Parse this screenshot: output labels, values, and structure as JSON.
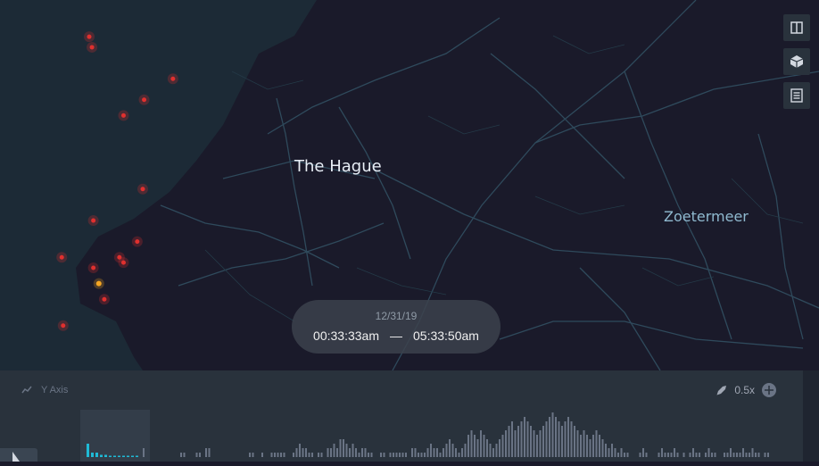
{
  "map": {
    "city_primary": "The Hague",
    "city_secondary": "Zoetermeer",
    "colors": {
      "water": "#1c2a36",
      "land": "#141420",
      "road": "#2f4a5c",
      "point": "#e0302e",
      "highlight": "#f5a623"
    },
    "points": [
      {
        "lng": 4.265,
        "lat": 52.118
      },
      {
        "lng": 4.267,
        "lat": 52.116
      },
      {
        "lng": 4.326,
        "lat": 52.11
      },
      {
        "lng": 4.29,
        "lat": 52.103
      },
      {
        "lng": 4.305,
        "lat": 52.106
      },
      {
        "lng": 4.304,
        "lat": 52.089
      },
      {
        "lng": 4.268,
        "lat": 52.083
      },
      {
        "lng": 4.3,
        "lat": 52.079
      },
      {
        "lng": 4.287,
        "lat": 52.076
      },
      {
        "lng": 4.29,
        "lat": 52.075
      },
      {
        "lng": 4.245,
        "lat": 52.076
      },
      {
        "lng": 4.268,
        "lat": 52.074
      },
      {
        "lng": 4.272,
        "lat": 52.071
      },
      {
        "lng": 4.276,
        "lat": 52.068
      },
      {
        "lng": 4.246,
        "lat": 52.063
      }
    ],
    "highlight_point_index": 12
  },
  "controls": {
    "split_icon": "split-map-icon",
    "view3d_icon": "cube-3d-icon",
    "legend_icon": "legend-icon"
  },
  "time": {
    "date": "12/31/19",
    "start": "00:33:33am",
    "separator": "—",
    "end": "05:33:50am"
  },
  "timeline": {
    "y_axis_label": "Y Axis",
    "speed": "0.5x",
    "highlight_color": "#1fbad6",
    "bar_color": "#6a7485",
    "bins": [
      2,
      0,
      0,
      0,
      0,
      0,
      0,
      0,
      0,
      0,
      0,
      0,
      1,
      1,
      0,
      0,
      0,
      1,
      1,
      0,
      2,
      2,
      0,
      0,
      0,
      0,
      0,
      0,
      0,
      0,
      0,
      0,
      0,
      0,
      1,
      1,
      0,
      0,
      1,
      0,
      0,
      1,
      1,
      1,
      1,
      1,
      0,
      0,
      1,
      2,
      3,
      2,
      2,
      1,
      1,
      0,
      1,
      1,
      0,
      2,
      2,
      3,
      2,
      4,
      4,
      3,
      2,
      3,
      2,
      1,
      2,
      2,
      1,
      1,
      0,
      0,
      1,
      1,
      0,
      1,
      1,
      1,
      1,
      1,
      1,
      0,
      2,
      2,
      1,
      1,
      1,
      2,
      3,
      2,
      2,
      1,
      2,
      3,
      4,
      3,
      2,
      1,
      2,
      3,
      5,
      6,
      5,
      4,
      6,
      5,
      4,
      3,
      2,
      3,
      4,
      5,
      6,
      7,
      8,
      6,
      7,
      8,
      9,
      8,
      7,
      6,
      5,
      6,
      7,
      8,
      9,
      10,
      9,
      8,
      7,
      8,
      9,
      8,
      7,
      6,
      5,
      6,
      5,
      4,
      5,
      6,
      5,
      4,
      3,
      2,
      3,
      2,
      1,
      2,
      1,
      1,
      0,
      0,
      0,
      1,
      2,
      1,
      0,
      0,
      0,
      1,
      2,
      1,
      1,
      1,
      2,
      1,
      0,
      1,
      0,
      1,
      2,
      1,
      1,
      0,
      1,
      2,
      1,
      1,
      0,
      0,
      1,
      1,
      2,
      1,
      1,
      1,
      2,
      1,
      1,
      2,
      1,
      1,
      0,
      1,
      1,
      0,
      0
    ],
    "highlight_bins": [
      3,
      1,
      1,
      0.5,
      0.5,
      0.3,
      0.3,
      0.3,
      0.3,
      0.3,
      0.3,
      0.3
    ]
  }
}
